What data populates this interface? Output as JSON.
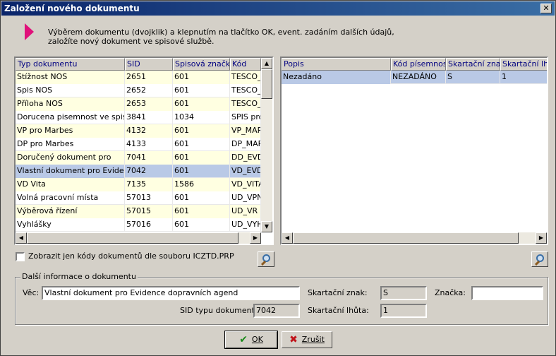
{
  "window": {
    "title": "Založení nového dokumentu",
    "close_glyph": "✕"
  },
  "info": {
    "line1": "Výběrem dokumentu (dvojklik) a klepnutím na tlačítko OK, event. zadáním dalších údajů,",
    "line2": "založíte nový dokument ve spisové službě."
  },
  "left_grid": {
    "columns": [
      "Typ dokumentu",
      "SID",
      "Spisová značka",
      "Kód"
    ],
    "rows": [
      [
        "Stížnost NOS",
        "2651",
        "601",
        "TESCO_S"
      ],
      [
        "Spis NOS",
        "2652",
        "601",
        "TESCO_S"
      ],
      [
        "Příloha NOS",
        "2653",
        "601",
        "TESCO_P"
      ],
      [
        "Dorucena pisemnost ve spisu",
        "3841",
        "1034",
        "SPIS pro"
      ],
      [
        "VP pro Marbes",
        "4132",
        "601",
        "VP_MARE"
      ],
      [
        "DP pro Marbes",
        "4133",
        "601",
        "DP_MARI"
      ],
      [
        "Doručený dokument pro",
        "7041",
        "601",
        "DD_EVDC"
      ],
      [
        "Vlastní dokument pro Evidence",
        "7042",
        "601",
        "VD_EVDC"
      ],
      [
        "VD Vita",
        "7135",
        "1586",
        "VD_VITA"
      ],
      [
        "Volná pracovní místa",
        "57013",
        "601",
        "UD_VPN"
      ],
      [
        "Výběrová řízení",
        "57015",
        "601",
        "UD_VR"
      ],
      [
        "Vyhlášky",
        "57016",
        "601",
        "UD_VYH"
      ]
    ],
    "selected_index": 7
  },
  "right_grid": {
    "columns": [
      "Popis",
      "Kód písemnosti",
      "Skartační znak",
      "Skartační lhůta"
    ],
    "rows": [
      [
        "Nezadáno",
        "NEZADÁNO",
        "S",
        "1"
      ]
    ],
    "selected_index": 0
  },
  "filter": {
    "checkbox_label": "Zobrazit jen kódy dokumentů dle souboru ICZTD.PRP",
    "checked": false
  },
  "details": {
    "group_title": "Další informace o dokumentu",
    "vec_label": "Věc:",
    "vec_value": "Vlastní dokument pro Evidence dopravních agend",
    "sid_label": "SID typu dokumentu:",
    "sid_value": "7042",
    "skart_znak_label": "Skartační znak:",
    "skart_znak_value": "S",
    "skart_lhuta_label": "Skartační lhůta:",
    "skart_lhuta_value": "1",
    "znacka_label": "Značka:",
    "znacka_value": ""
  },
  "buttons": {
    "ok_label": "OK",
    "cancel_label": "Zrušit"
  },
  "icons": {
    "ok": "checkmark-icon",
    "cancel": "x-icon",
    "search": "magnifier-icon"
  },
  "colors": {
    "title_bar": "#0a246a",
    "selected_row": "#b9c9e6",
    "first_column": "#ffffe1",
    "arrow": "#e0107a"
  }
}
